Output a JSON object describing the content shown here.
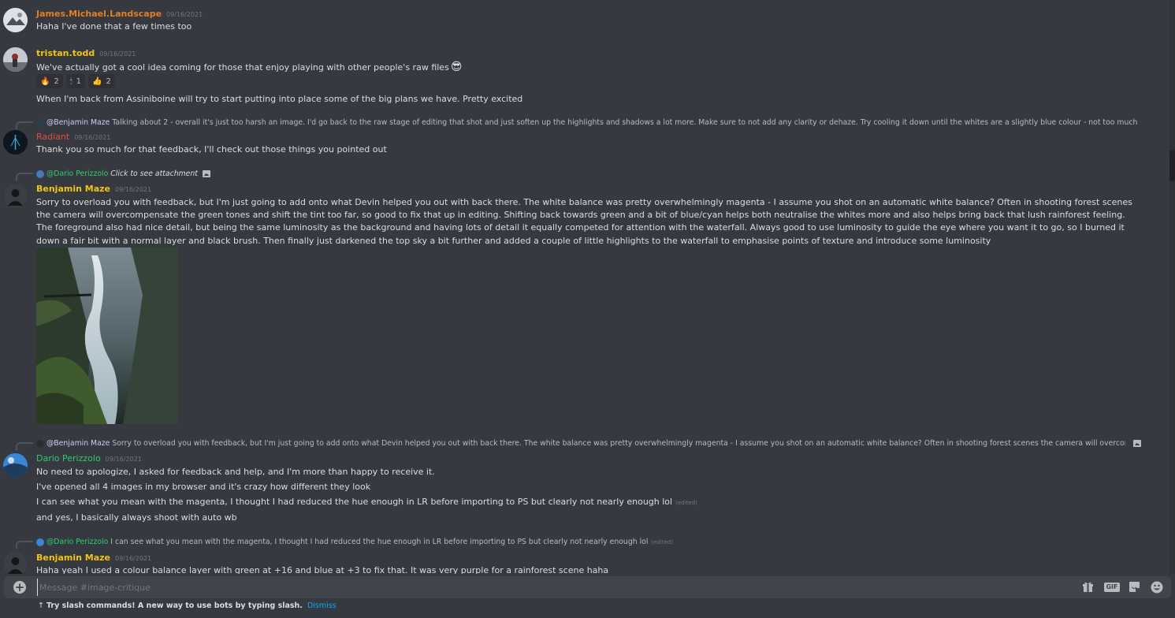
{
  "messages": {
    "m1": {
      "author": "James.Michael.Landscape",
      "timestamp": "09/16/2021",
      "text": "Haha I've done that a few times too"
    },
    "m2": {
      "author": "tristan.todd",
      "timestamp": "09/16/2021",
      "text1": "We've actually got a cool idea coming for those that enjoy playing with other people's raw files",
      "emoji": "😎",
      "reactions": [
        {
          "emoji": "🔥",
          "count": "2"
        },
        {
          "emoji": "🕯",
          "count": "1"
        },
        {
          "emoji": "👍",
          "count": "2"
        }
      ],
      "text2": "When I'm back from Assiniboine will try to start putting into place some of the big plans we have. Pretty excited"
    },
    "m3": {
      "reply_author": "@Benjamin Maze",
      "reply_text": "Talking about 2 - overall it's just too harsh an image. I'd go back to the raw stage of editing that shot and just soften up the highlights and shadows a lot more. Make sure to not add any clarity or dehaze. Try cooling it down until the whites are a slightly blue colour - not too much though. You could als...",
      "author": "Radiant",
      "timestamp": "09/16/2021",
      "text": "Thank you so much for that feedback, I'll check out those things you pointed out"
    },
    "m4": {
      "reply_author": "@Dario Perizzolo",
      "reply_text": "Click to see attachment",
      "author": "Benjamin Maze",
      "timestamp": "09/16/2021",
      "text": "Sorry to overload you with feedback, but I'm just going to add onto what Devin helped you out with back there. The white balance was pretty overwhelmingly magenta - I assume you shot on an automatic white balance? Often in shooting forest scenes the camera will overcompensate the green tones and shift the tint too far, so good to fix that up in editing. Shifting back towards green and a bit of blue/cyan helps both neutralise the whites more and also helps bring back that lush rainforest feeling. The foreground also had nice detail, but being the same luminosity as the background and having lots of detail it equally competed for attention with the waterfall. Always good to use luminosity to guide the eye where you want it to go, so I burned it down a fair bit with a normal layer and black brush. Then finally just darkened the top sky a bit further and added a couple of little highlights to the waterfall to emphasise points of texture and introduce some luminosity"
    },
    "m5": {
      "reply_author": "@Benjamin Maze",
      "reply_text": "Sorry to overload you with feedback, but I'm just going to add onto what Devin helped you out with back there. The white balance was pretty overwhelmingly magenta - I assume you shot on an automatic white balance? Often in shooting forest scenes the camera will overcompensate the green t...",
      "author": "Dario Perizzolo",
      "timestamp": "09/16/2021",
      "lines": [
        "No need to apologize, I asked for feedback and help, and I'm more than happy to receive it.",
        "I've opened all 4 images in my browser and it's crazy how different they look",
        "I can see what you mean with the magenta, I thought I had reduced the hue enough in LR before importing to PS but clearly not nearly enough lol",
        "and yes, I basically always shoot with auto wb"
      ],
      "edited": "(edited)"
    },
    "m6": {
      "reply_author": "@Dario Perizzolo",
      "reply_text": "I can see what you mean with the magenta, I thought I had reduced the hue enough in LR before importing to PS but clearly not nearly enough lol",
      "reply_edited": "(edited)",
      "author": "Benjamin Maze",
      "timestamp": "09/16/2021",
      "text": "Haha yeah I used a colour balance layer with green at +16 and blue at +3 to fix that. It was very purple for a rainforest scene haha"
    }
  },
  "composer": {
    "placeholder": "Message #image-critique",
    "gif_label": "GIF"
  },
  "hint": {
    "arrow": "↑",
    "text": "Try slash commands! A new way to use bots by typing slash.",
    "dismiss": "Dismiss"
  },
  "colors": {
    "orange": "#e67e22",
    "yellow": "#f1c40f",
    "green": "#2ecc71",
    "red": "#e74c3c",
    "link": "#00aff4"
  },
  "icons": [
    "plus-circle-icon",
    "gift-icon",
    "gif-icon",
    "sticker-icon",
    "emoji-icon",
    "image-icon"
  ]
}
